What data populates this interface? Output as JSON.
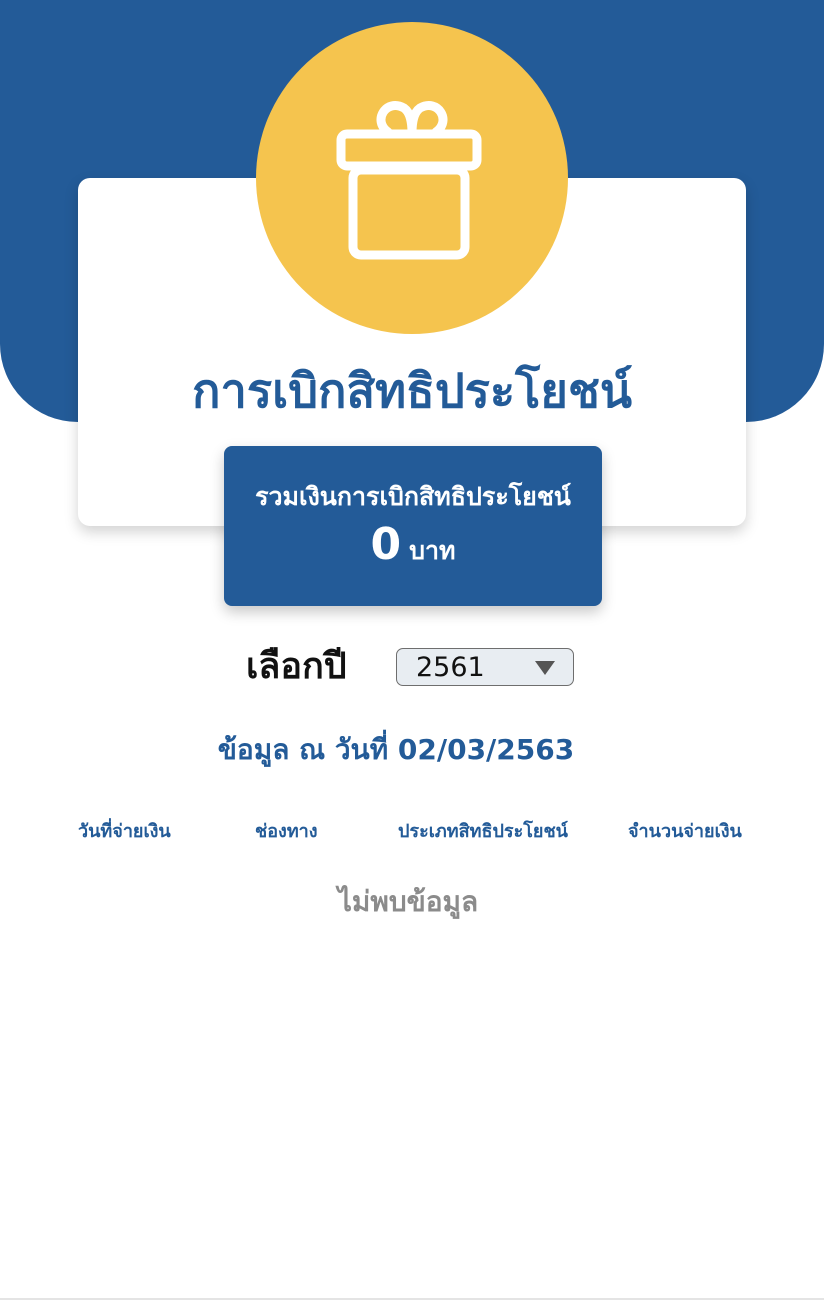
{
  "header": {
    "title": "การเบิกสิทธิประโยชน์",
    "icon": "gift-icon",
    "colors": {
      "header_blue": "#235b98",
      "icon_circle": "#f5c44e"
    }
  },
  "summary": {
    "label": "รวมเงินการเบิกสิทธิประโยชน์",
    "amount": "0",
    "unit": "บาท"
  },
  "filter": {
    "year_label": "เลือกปี",
    "selected_year": "2561"
  },
  "data_as_of": "ข้อมูล ณ วันที่ 02/03/2563",
  "table": {
    "columns": [
      "วันที่จ่ายเงิน",
      "ช่องทาง",
      "ประเภทสิทธิประโยชน์",
      "จำนวนจ่ายเงิน"
    ],
    "rows": [],
    "empty_message": "ไม่พบข้อมูล"
  }
}
